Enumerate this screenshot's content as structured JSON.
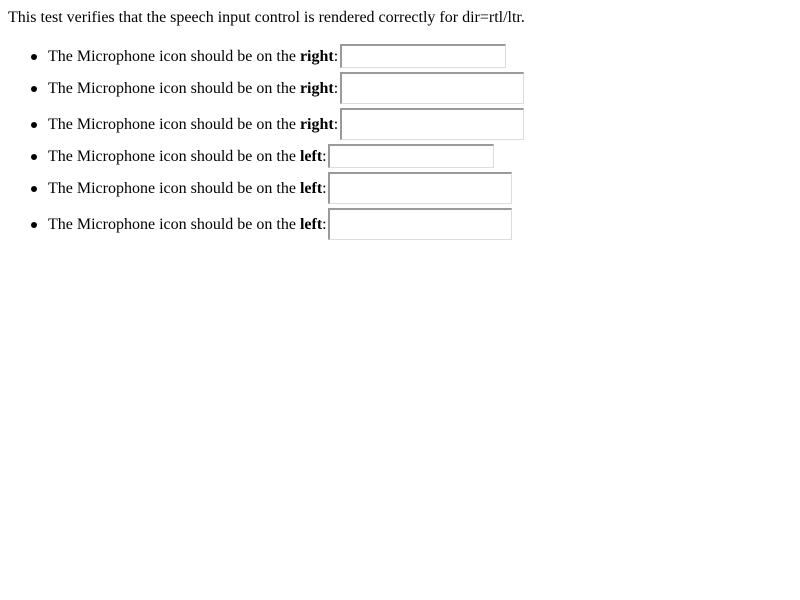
{
  "intro_text": "This test verifies that the speech input control is rendered correctly for dir=rtl/ltr.",
  "items": [
    {
      "prefix": "The Microphone icon should be on the ",
      "emphasis": "right",
      "suffix": ":",
      "value": ""
    },
    {
      "prefix": "The Microphone icon should be on the ",
      "emphasis": "right",
      "suffix": ":",
      "value": ""
    },
    {
      "prefix": "The Microphone icon should be on the ",
      "emphasis": "right",
      "suffix": ":",
      "value": ""
    },
    {
      "prefix": "The Microphone icon should be on the ",
      "emphasis": "left",
      "suffix": ":",
      "value": ""
    },
    {
      "prefix": "The Microphone icon should be on the ",
      "emphasis": "left",
      "suffix": ":",
      "value": ""
    },
    {
      "prefix": "The Microphone icon should be on the ",
      "emphasis": "left",
      "suffix": ":",
      "value": ""
    }
  ]
}
